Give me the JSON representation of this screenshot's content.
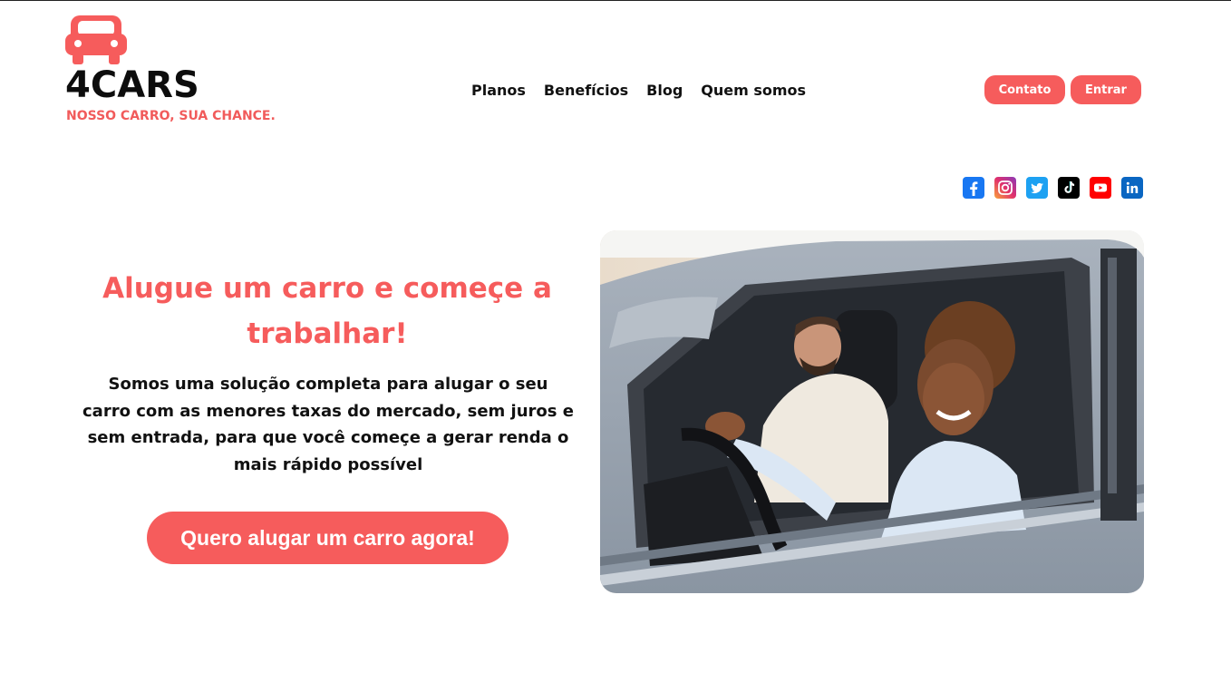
{
  "brand": {
    "name": "4CARS",
    "tagline": "NOSSO CARRO, SUA CHANCE.",
    "logo_icon": "car-icon",
    "accent_color": "#f65c5c"
  },
  "nav": {
    "items": [
      {
        "label": "Planos"
      },
      {
        "label": "Benefícios"
      },
      {
        "label": "Blog"
      },
      {
        "label": "Quem somos"
      }
    ]
  },
  "header_buttons": {
    "contact_label": "Contato",
    "login_label": "Entrar"
  },
  "social": [
    {
      "icon": "facebook-icon",
      "color": "#1877f2"
    },
    {
      "icon": "instagram-icon",
      "color": "#c13584"
    },
    {
      "icon": "twitter-icon",
      "color": "#1da1f2"
    },
    {
      "icon": "tiktok-icon",
      "color": "#000000"
    },
    {
      "icon": "youtube-icon",
      "color": "#ff0000"
    },
    {
      "icon": "linkedin-icon",
      "color": "#0a66c2"
    }
  ],
  "hero": {
    "title": "Alugue um carro e começe a trabalhar!",
    "text": "Somos uma solução completa para alugar o seu carro com as menores taxas do mercado, sem juros e sem entrada, para que você começe a gerar renda o mais rápido possível",
    "cta_label": "Quero alugar um carro agora!"
  }
}
